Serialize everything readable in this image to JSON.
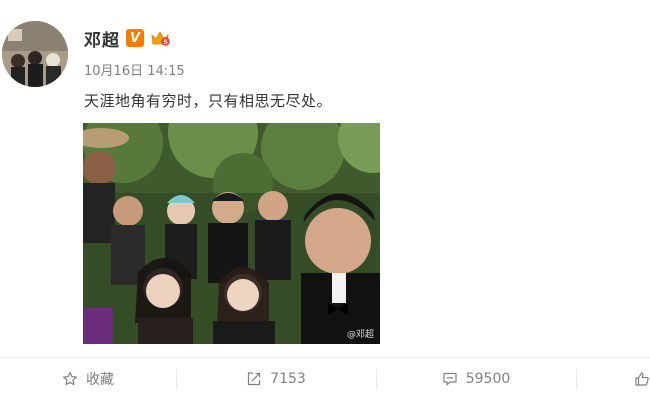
{
  "post": {
    "username": "邓超",
    "vip_badge": "V",
    "timestamp": "10月16日 14:15",
    "text": "天涯地角有穷时，只有相思无尽处。",
    "photo_watermark": "@邓超"
  },
  "actions": {
    "favorite_label": "收藏",
    "forward_count": "7153",
    "comment_count": "59500",
    "like_count": ""
  },
  "icons": {
    "favorite": "star-icon",
    "forward": "share-icon",
    "comment": "comment-icon",
    "like": "thumbs-up-icon",
    "vip": "verified-badge-icon",
    "member": "crown-badge-icon"
  },
  "colors": {
    "username": "#333333",
    "timestamp": "#808080",
    "vip_badge": "#f57c00",
    "action_text": "#808080"
  }
}
